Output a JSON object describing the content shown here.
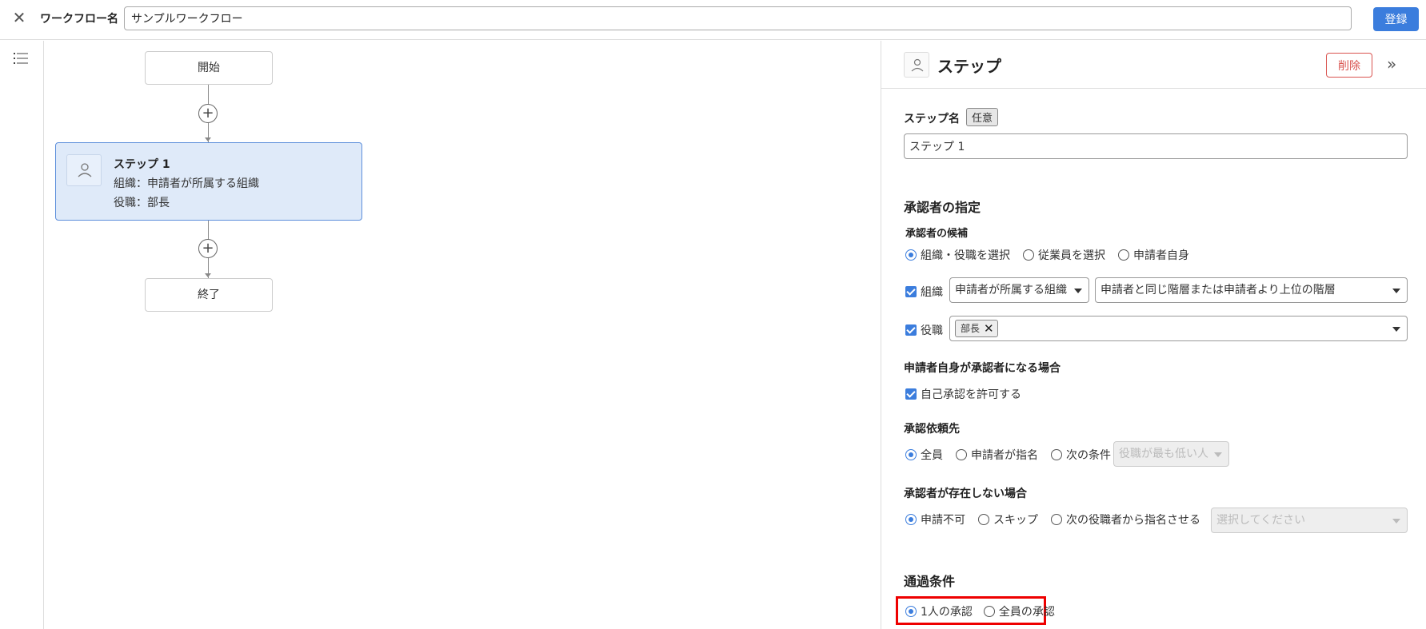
{
  "header": {
    "close_icon": "close-icon",
    "workflow_name_label": "ワークフロー名",
    "workflow_name_value": "サンプルワークフロー",
    "register_label": "登録"
  },
  "sidebar": {
    "list_icon": "list-icon"
  },
  "canvas": {
    "start_label": "開始",
    "end_label": "終了",
    "add_icon": "+",
    "step": {
      "title": "ステップ 1",
      "org_line": "組織：申請者が所属する組織",
      "role_line": "役職：部長"
    }
  },
  "panel": {
    "title": "ステップ",
    "delete_label": "削除",
    "collapse_icon": "»",
    "step_name_label": "ステップ名",
    "optional_tag": "任意",
    "step_name_value": "ステップ 1",
    "approver_section_title": "承認者の指定",
    "candidates_label": "承認者の候補",
    "candidates_options": [
      "組織・役職を選択",
      "従業員を選択",
      "申請者自身"
    ],
    "org_label": "組織",
    "org_select_value": "申請者が所属する組織",
    "org_level_select_value": "申請者と同じ階層または申請者より上位の階層",
    "role_label": "役職",
    "role_chip": "部長",
    "self_approval_section": "申請者自身が承認者になる場合",
    "self_approval_check": "自己承認を許可する",
    "request_to_label": "承認依頼先",
    "request_to_options": [
      "全員",
      "申請者が指名",
      "次の条件"
    ],
    "request_to_condition_placeholder": "役職が最も低い人",
    "no_approver_label": "承認者が存在しない場合",
    "no_approver_options": [
      "申請不可",
      "スキップ",
      "次の役職者から指名させる"
    ],
    "no_approver_select_placeholder": "選択してください",
    "pass_condition_title": "通過条件",
    "pass_condition_options": [
      "1人の承認",
      "全員の承認"
    ]
  },
  "colors": {
    "accent": "#3b7ddd",
    "danger": "#d9534f",
    "step_bg": "#dfeaf9",
    "highlight": "#e00000"
  }
}
